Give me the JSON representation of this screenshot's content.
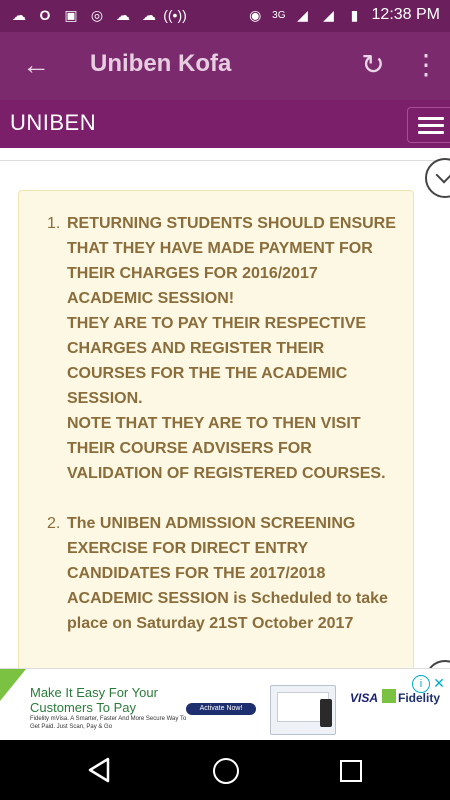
{
  "status_bar": {
    "network_label": "3G",
    "time": "12:38 PM",
    "icons": [
      "cloud-icon",
      "opera-icon",
      "image-icon",
      "instagram-icon",
      "cloud-icon",
      "cloud-icon",
      "broadcast-icon",
      "hotspot-icon",
      "signal-icon",
      "sim-icon",
      "battery-icon"
    ]
  },
  "app_bar": {
    "title": "Uniben Kofa",
    "back_icon": "arrow-left-icon",
    "refresh_icon": "refresh-icon",
    "more_icon": "more-vert-icon"
  },
  "site_nav": {
    "brand": "UNIBEN",
    "menu_icon": "hamburger-icon"
  },
  "notices": [
    {
      "number": "1.",
      "paragraphs": [
        "RETURNING STUDENTS SHOULD ENSURE THAT THEY HAVE MADE PAYMENT FOR THEIR CHARGES FOR 2016/2017 ACADEMIC SESSION!",
        "THEY ARE TO PAY THEIR RESPECTIVE CHARGES AND REGISTER THEIR COURSES FOR THE THE ACADEMIC SESSION.",
        "NOTE THAT THEY ARE TO THEN VISIT THEIR COURSE ADVISERS FOR VALIDATION OF REGISTERED COURSES."
      ]
    },
    {
      "number": "2.",
      "paragraphs": [
        "The UNIBEN ADMISSION SCREENING EXERCISE FOR DIRECT ENTRY CANDIDATES FOR THE 2017/2018 ACADEMIC SESSION is Scheduled to take place on Saturday 21ST October 2017"
      ]
    }
  ],
  "ad": {
    "headline": "Make It Easy For Your Customers To Pay",
    "subtext": "Fidelity mVisa. A Smarter, Faster And More Secure Way To Get Paid. Just Scan, Pay & Go",
    "cta": "Activate Now!",
    "visa": "VISA",
    "fidelity": "Fidelity",
    "info_icon": "info-icon",
    "close_icon": "close-icon"
  },
  "system_nav": {
    "back_icon": "back-triangle-icon",
    "home_icon": "home-circle-icon",
    "recent_icon": "recent-square-icon"
  },
  "colors": {
    "status_bar": "#6b1f5c",
    "app_bar": "#7b2a6e",
    "site_nav": "#7b1f6b",
    "notice_bg": "#fcf8e3",
    "notice_text": "#8a6d3b"
  }
}
